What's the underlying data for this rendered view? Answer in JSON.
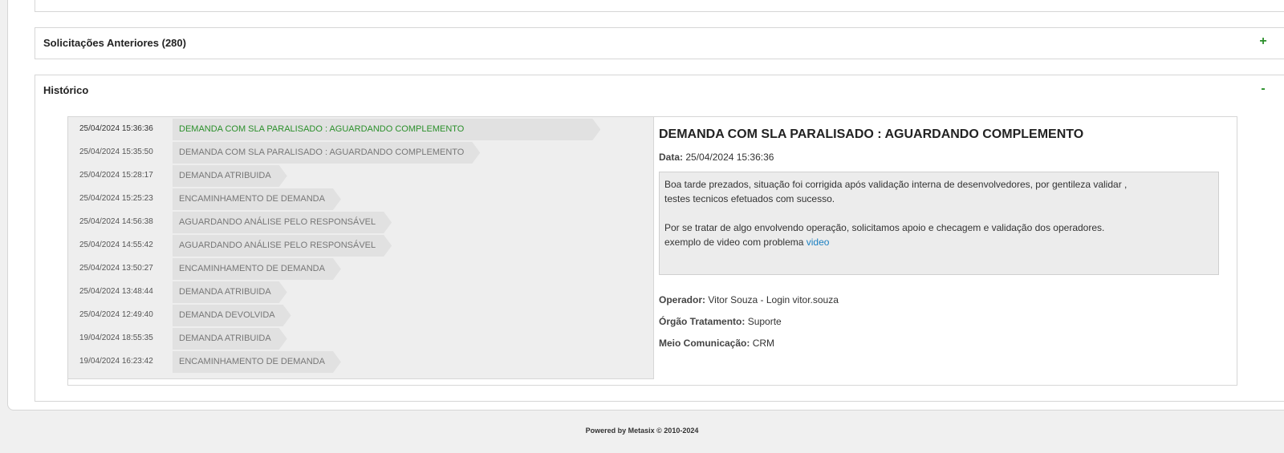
{
  "panels": {
    "previous_requests": {
      "title": "Solicitações Anteriores (280)",
      "toggle": "+"
    },
    "history": {
      "title": "Histórico",
      "toggle": "-"
    }
  },
  "timeline": [
    {
      "date": "25/04/2024 15:36:36",
      "status": "DEMANDA COM SLA PARALISADO : AGUARDANDO COMPLEMENTO",
      "active": true
    },
    {
      "date": "25/04/2024 15:35:50",
      "status": "DEMANDA COM SLA PARALISADO : AGUARDANDO COMPLEMENTO"
    },
    {
      "date": "25/04/2024 15:28:17",
      "status": "DEMANDA ATRIBUIDA"
    },
    {
      "date": "25/04/2024 15:25:23",
      "status": "ENCAMINHAMENTO DE DEMANDA"
    },
    {
      "date": "25/04/2024 14:56:38",
      "status": "AGUARDANDO ANÁLISE PELO RESPONSÁVEL"
    },
    {
      "date": "25/04/2024 14:55:42",
      "status": "AGUARDANDO ANÁLISE PELO RESPONSÁVEL"
    },
    {
      "date": "25/04/2024 13:50:27",
      "status": "ENCAMINHAMENTO DE DEMANDA"
    },
    {
      "date": "25/04/2024 13:48:44",
      "status": "DEMANDA ATRIBUIDA"
    },
    {
      "date": "25/04/2024 12:49:40",
      "status": "DEMANDA DEVOLVIDA"
    },
    {
      "date": "19/04/2024 18:55:35",
      "status": "DEMANDA ATRIBUIDA"
    },
    {
      "date": "19/04/2024 16:23:42",
      "status": "ENCAMINHAMENTO DE DEMANDA"
    }
  ],
  "detail": {
    "title": "DEMANDA COM SLA PARALISADO : AGUARDANDO COMPLEMENTO",
    "date_label": "Data:",
    "date_value": "25/04/2024 15:36:36",
    "message": {
      "line1": "Boa tarde prezados, situação foi corrigida após validação interna de desenvolvedores, por gentileza validar ,",
      "line2": "testes tecnicos efetuados com sucesso.",
      "line3": "Por se tratar de algo envolvendo operação, solicitamos apoio e checagem e validação dos operadores.",
      "line4_prefix": "exemplo de video com problema ",
      "link_text": "video"
    },
    "operator_label": "Operador:",
    "operator_value": "Vitor Souza - Login vitor.souza",
    "org_label": "Órgão Tratamento:",
    "org_value": "Suporte",
    "channel_label": "Meio Comunicação:",
    "channel_value": "CRM"
  },
  "footer": {
    "text": "Powered by Metasix © 2010-2024"
  },
  "colors": {
    "active_status": "#2a8f2a",
    "link": "#1a7fc1",
    "toggle": "#2a8f2a"
  }
}
